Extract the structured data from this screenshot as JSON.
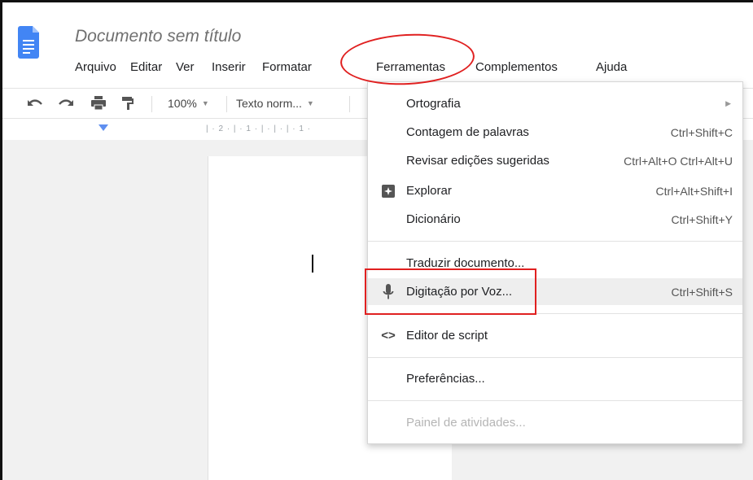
{
  "document": {
    "title": "Documento sem título"
  },
  "menubar": {
    "items": [
      "Arquivo",
      "Editar",
      "Ver",
      "Inserir",
      "Formatar",
      "Ferramentas",
      "Complementos",
      "Ajuda"
    ]
  },
  "toolbar": {
    "zoom": "100%",
    "style": "Texto norm..."
  },
  "ruler": {
    "text": "| · 2 · | · 1 · | · | · | · 1 ·"
  },
  "tools_menu": {
    "items": [
      {
        "label": "Ortografia",
        "shortcut": "",
        "submenu": true
      },
      {
        "label": "Contagem de palavras",
        "shortcut": "Ctrl+Shift+C"
      },
      {
        "label": "Revisar edições sugeridas",
        "shortcut": "Ctrl+Alt+O Ctrl+Alt+U"
      },
      {
        "label": "Explorar",
        "shortcut": "Ctrl+Alt+Shift+I",
        "icon": "explore-icon"
      },
      {
        "label": "Dicionário",
        "shortcut": "Ctrl+Shift+Y"
      },
      {
        "label": "Traduzir documento...",
        "shortcut": ""
      },
      {
        "label": "Digitação por Voz...",
        "shortcut": "Ctrl+Shift+S",
        "icon": "microphone-icon",
        "highlighted": true
      },
      {
        "label": "Editor de script",
        "shortcut": "",
        "icon": "code-icon"
      },
      {
        "label": "Preferências...",
        "shortcut": ""
      },
      {
        "label": "Painel de atividades...",
        "shortcut": "",
        "disabled": true
      }
    ]
  },
  "colors": {
    "accent_blue": "#4285f4",
    "annotation_red": "#e02020",
    "highlight_row": "#eeeeee"
  }
}
